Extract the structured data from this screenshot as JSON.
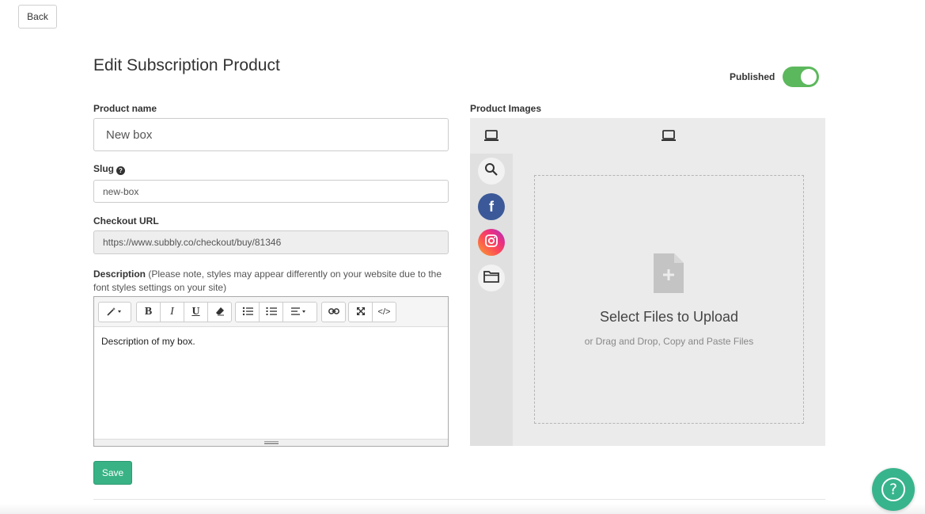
{
  "header": {
    "back_label": "Back",
    "title": "Edit Subscription Product",
    "published_label": "Published",
    "published": true
  },
  "form": {
    "product_name_label": "Product name",
    "product_name_value": "New box",
    "slug_label": "Slug",
    "slug_value": "new-box",
    "checkout_url_label": "Checkout URL",
    "checkout_url_value": "https://www.subbly.co/checkout/buy/81346",
    "description_label": "Description",
    "description_hint": " (Please note, styles may appear differently on your website due to the font styles settings on your site)",
    "description_value": "Description of my box.",
    "save_label": "Save"
  },
  "editor_toolbar": [
    [
      "magic-wand-icon"
    ],
    [
      "bold-icon",
      "italic-icon",
      "underline-icon",
      "eraser-icon"
    ],
    [
      "unordered-list-icon",
      "ordered-list-icon",
      "align-icon"
    ],
    [
      "link-icon"
    ],
    [
      "fullscreen-icon",
      "code-view-icon"
    ]
  ],
  "images": {
    "label": "Product Images",
    "upload_title": "Select Files to Upload",
    "upload_subtitle": "or Drag and Drop, Copy and Paste Files",
    "sources": [
      "search-icon",
      "facebook-icon",
      "instagram-icon",
      "folder-icon"
    ]
  },
  "colors": {
    "toggle_on": "#5cb85c",
    "save_button": "#39b386",
    "facebook": "#3b5998",
    "help_button": "#38b48c"
  }
}
